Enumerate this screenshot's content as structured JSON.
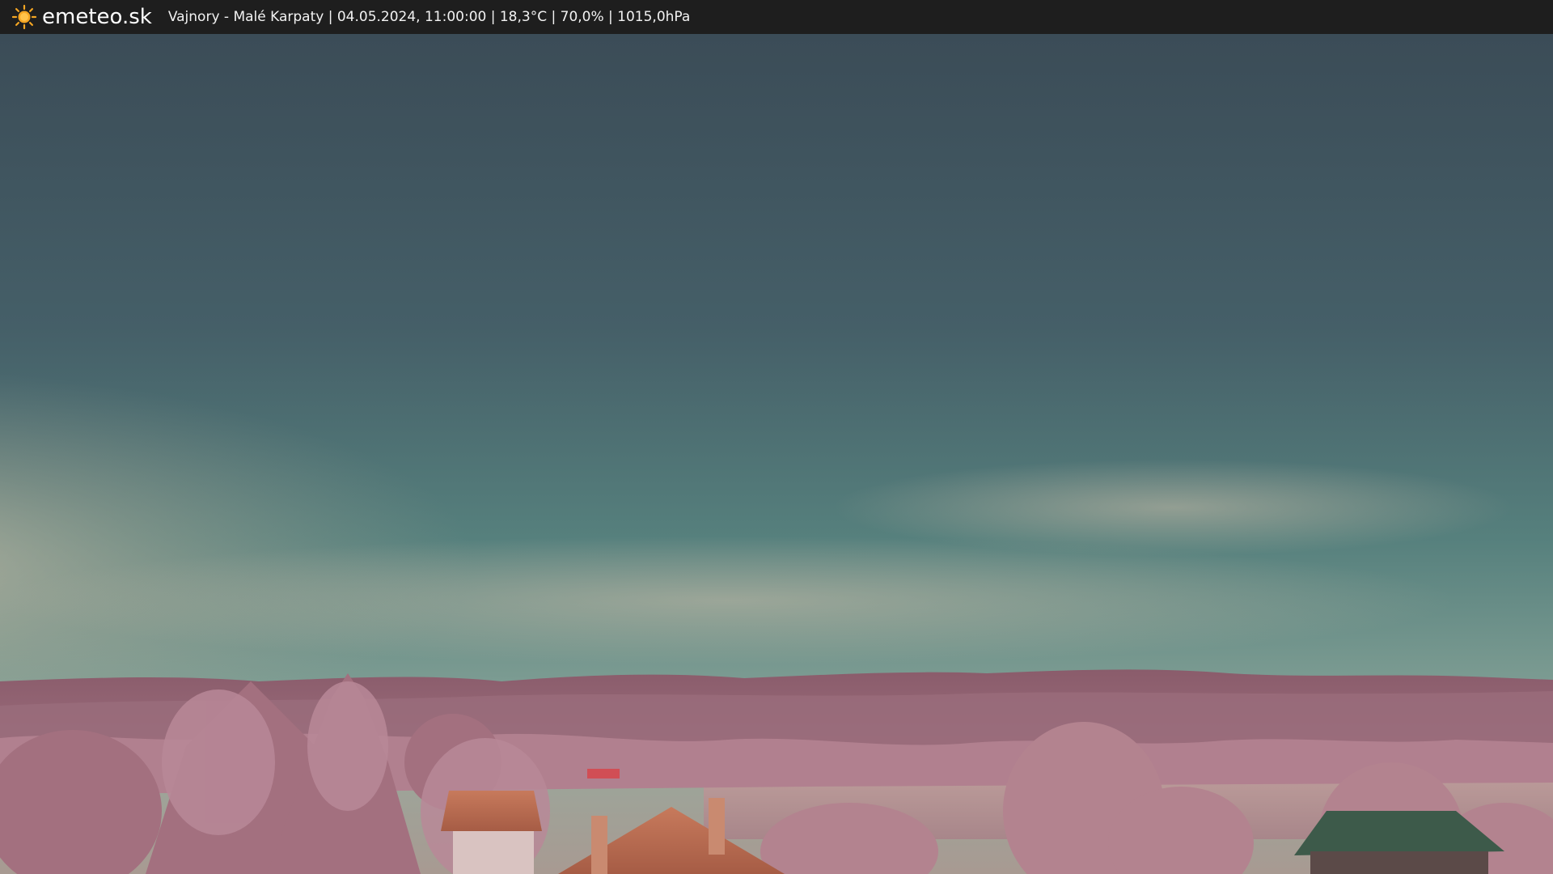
{
  "header": {
    "logo_text": "emeteo.sk",
    "logo_icon": "sun-icon",
    "caption": "Vajnory - Malé Karpaty | 04.05.2024, 11:00:00 | 18,3°C | 70,0% | 1015,0hPa"
  },
  "colors": {
    "header_bg": "#1e1e1e",
    "logo_sun": "#f5a623",
    "sky_top": "#3c4e58",
    "sky_mid": "#4f7a78",
    "sky_horizon": "#8fa59b",
    "haze": "#cdbfae",
    "hills": "#8c5f6e",
    "foliage": "#b07e90",
    "field": "#b89696",
    "roof": "#b8674d"
  }
}
